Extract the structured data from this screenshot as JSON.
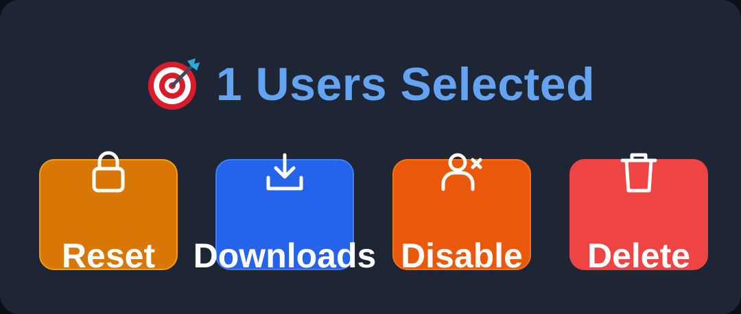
{
  "header": {
    "icon": "direct-hit-target-icon",
    "title": "1 Users Selected"
  },
  "actions": [
    {
      "label": "Reset",
      "icon": "lock-icon",
      "color": "#d97706"
    },
    {
      "label": "Downloads",
      "icon": "download-icon",
      "color": "#2563eb"
    },
    {
      "label": "Disable",
      "icon": "user-x-icon",
      "color": "#ea580c"
    },
    {
      "label": "Delete",
      "icon": "trash-icon",
      "color": "#ef4444"
    }
  ],
  "colors": {
    "background": "#1e2636",
    "title": "#63a3f2",
    "label": "#ffffff"
  }
}
